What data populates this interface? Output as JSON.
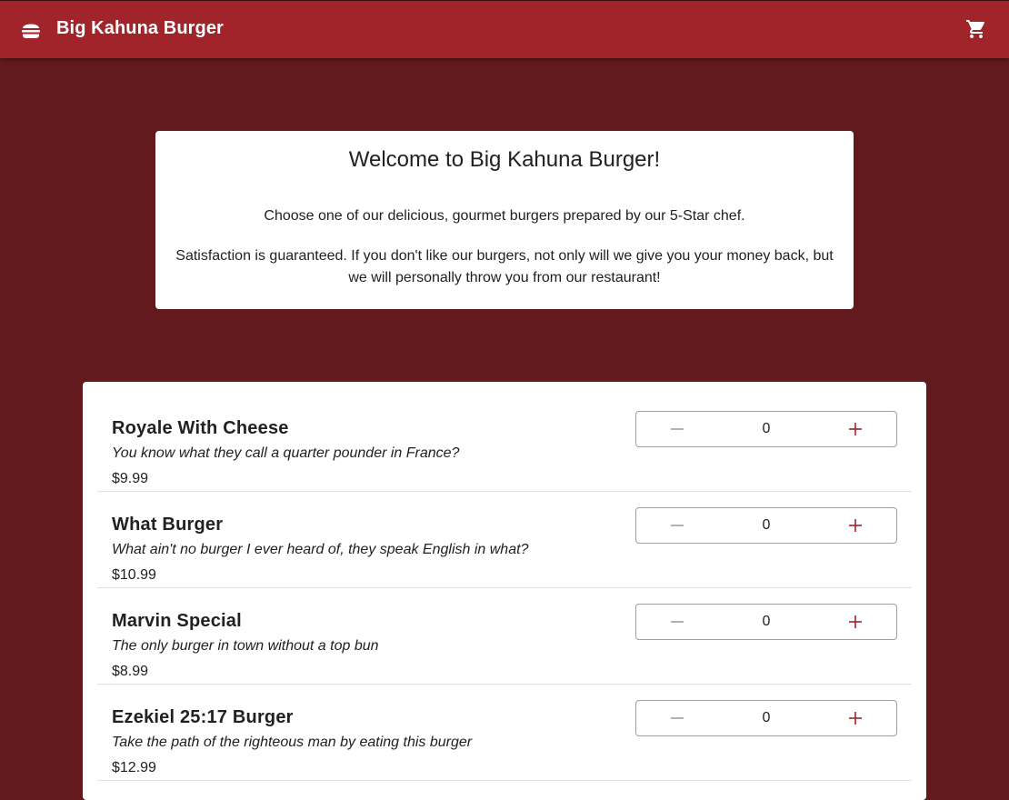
{
  "app": {
    "title": "Big Kahuna Burger",
    "brand_icon": "burger-icon",
    "cart_icon": "shopping-cart-icon"
  },
  "welcome": {
    "heading": "Welcome to Big Kahuna Burger!",
    "line1": "Choose one of our delicious, gourmet burgers prepared by our 5-Star chef.",
    "line2": "Satisfaction is guaranteed. If you don't like our burgers, not only will we give you your money back, but we will personally throw you from our restaurant!"
  },
  "menu": {
    "items": [
      {
        "name": "Royale With Cheese",
        "description": "You know what they call a quarter pounder in France?",
        "price": "$9.99",
        "quantity": "0"
      },
      {
        "name": "What Burger",
        "description": "What ain't no burger I ever heard of, they speak English in what?",
        "price": "$10.99",
        "quantity": "0"
      },
      {
        "name": "Marvin Special",
        "description": "The only burger in town without a top bun",
        "price": "$8.99",
        "quantity": "0"
      },
      {
        "name": "Ezekiel 25:17 Burger",
        "description": "Take the path of the righteous man by eating this burger",
        "price": "$12.99",
        "quantity": "0"
      }
    ],
    "decrement_icon": "minus-icon",
    "increment_icon": "plus-icon"
  },
  "colors": {
    "background": "#631a1e",
    "appbar": "#a0242a",
    "accent": "#a0242a",
    "disabled": "#9e9e9e"
  }
}
